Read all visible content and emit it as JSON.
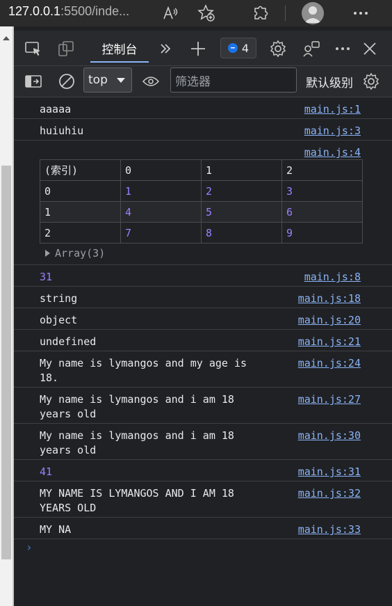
{
  "browser": {
    "url_host": "127.0.0.1",
    "url_rest": ":5500/inde..."
  },
  "devtools": {
    "console_tab": "控制台",
    "issues_count": "4",
    "context": "top",
    "filter_placeholder": "筛选器",
    "levels_label": "默认级别"
  },
  "console": {
    "m1": {
      "text": "aaaaa",
      "src": "main.js:1"
    },
    "m2": {
      "text": "huiuhiu",
      "src": "main.js:3"
    },
    "m3": {
      "src": "main.js:4"
    },
    "table": {
      "headers": [
        "(索引)",
        "0",
        "1",
        "2"
      ],
      "rows": [
        [
          "0",
          "1",
          "2",
          "3"
        ],
        [
          "1",
          "4",
          "5",
          "6"
        ],
        [
          "2",
          "7",
          "8",
          "9"
        ]
      ],
      "array_label": "Array(3)"
    },
    "m4": {
      "text": "31",
      "src": "main.js:8"
    },
    "m5": {
      "text": "string",
      "src": "main.js:18"
    },
    "m6": {
      "text": "object",
      "src": "main.js:20"
    },
    "m7": {
      "text": "undefined",
      "src": "main.js:21"
    },
    "m8": {
      "line1": "My name is lymangos and my age is",
      "line2": "18.",
      "src": "main.js:24"
    },
    "m9": {
      "line1": "My name is lymangos and i am 18",
      "line2": "years old",
      "src": "main.js:27"
    },
    "m10": {
      "line1": "My name is lymangos and i am 18",
      "line2": "years old",
      "src": "main.js:30"
    },
    "m11": {
      "text": "41",
      "src": "main.js:31"
    },
    "m12": {
      "line1": "MY NAME IS LYMANGOS AND I AM 18",
      "line2": "YEARS OLD",
      "src": "main.js:32"
    },
    "m13": {
      "text": "MY NA",
      "src": "main.js:33"
    },
    "prompt": "›"
  }
}
